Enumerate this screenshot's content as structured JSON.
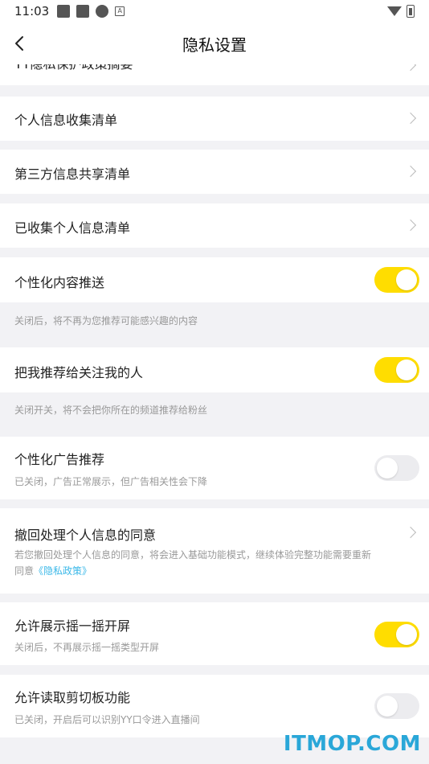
{
  "status": {
    "time": "11:03"
  },
  "nav": {
    "title": "隐私设置"
  },
  "partial_item": "YY隐私保护政策摘要",
  "items": [
    {
      "label": "个人信息收集清单"
    },
    {
      "label": "第三方信息共享清单"
    },
    {
      "label": "已收集个人信息清单"
    }
  ],
  "personalized_content": {
    "label": "个性化内容推送",
    "on": true,
    "note": "关闭后，将不再为您推荐可能感兴趣的内容"
  },
  "recommend_to_followers": {
    "label": "把我推荐给关注我的人",
    "on": true,
    "note": "关闭开关，将不会把你所在的频道推荐给粉丝"
  },
  "personalized_ads": {
    "label": "个性化广告推荐",
    "on": false,
    "note": "已关闭，广告正常展示，但广告相关性会下降"
  },
  "withdraw_consent": {
    "label": "撤回处理个人信息的同意",
    "note_line1": "若您撤回处理个人信息的同意，将会进入基础功能模式，继续体验完整功能需要重新",
    "note_line2_prefix": "同意",
    "note_link": "《隐私政策》"
  },
  "shake_screen": {
    "label": "允许展示摇一摇开屏",
    "on": true,
    "note": "关闭后，不再展示摇一摇类型开屏"
  },
  "clipboard": {
    "label": "允许读取剪切板功能",
    "on": false,
    "note": "已关闭，开启后可以识别YY口令进入直播间"
  },
  "watermark": "ITMOP.COM",
  "colors": {
    "accent": "#ffdd00",
    "link": "#3bb8e8",
    "background": "#f2f2f5"
  }
}
